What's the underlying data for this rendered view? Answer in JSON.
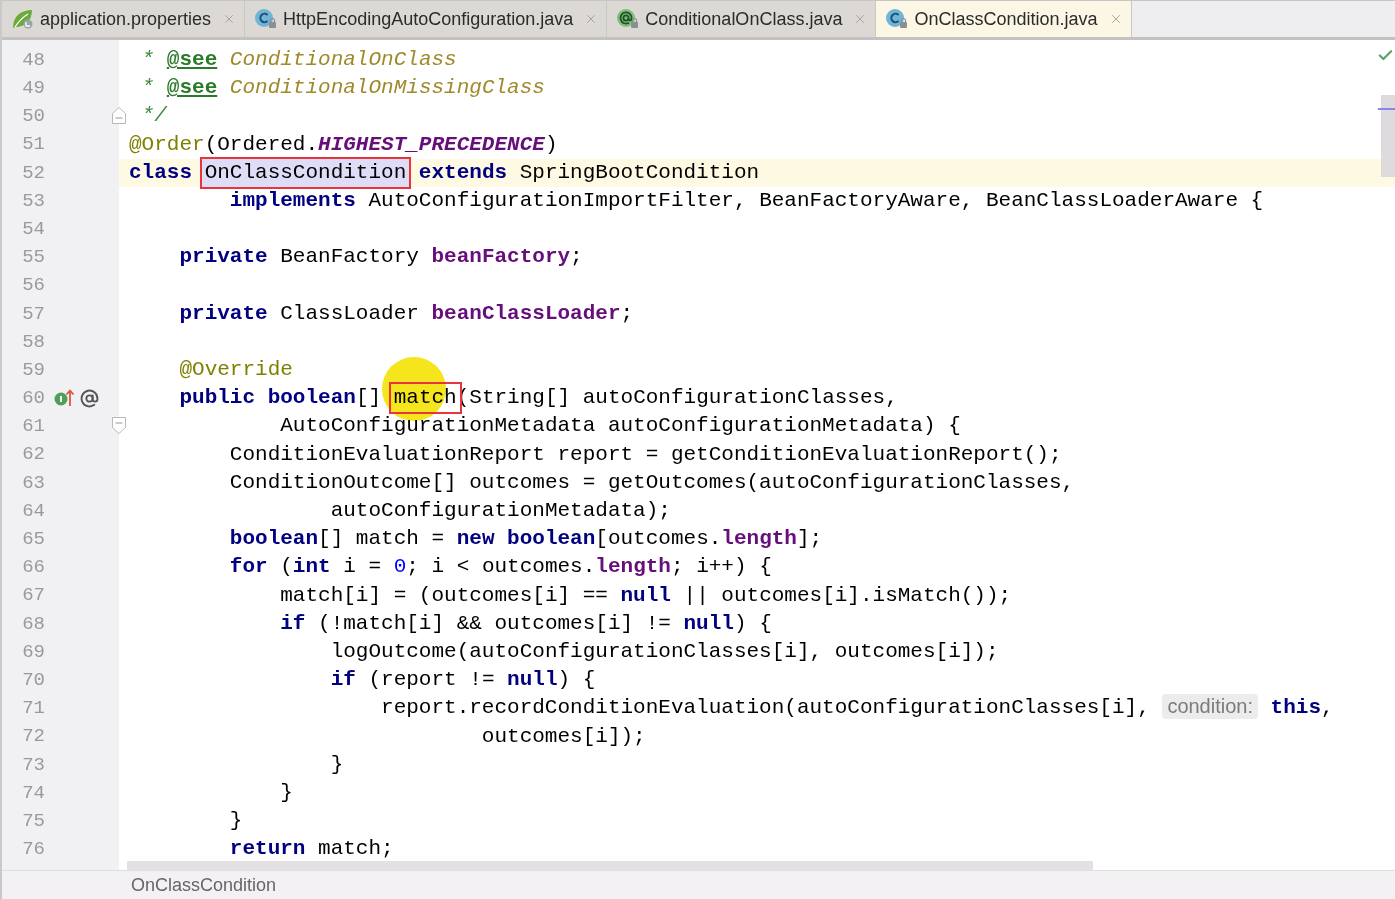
{
  "tabs": [
    {
      "label": "application.properties",
      "kind": "properties",
      "selected": false
    },
    {
      "label": "HttpEncodingAutoConfiguration.java",
      "kind": "class",
      "selected": false
    },
    {
      "label": "ConditionalOnClass.java",
      "kind": "annotation",
      "selected": false
    },
    {
      "label": "OnClassCondition.java",
      "kind": "class",
      "selected": true
    }
  ],
  "editor": {
    "lines": [
      {
        "number": "48",
        "current": false,
        "tokens": [
          {
            "kind": "doc",
            "text": " * "
          },
          {
            "kind": "doc_tag",
            "text": "@see"
          },
          {
            "kind": "doc_ref",
            "text": " ConditionalOnClass"
          }
        ]
      },
      {
        "number": "49",
        "current": false,
        "tokens": [
          {
            "kind": "doc",
            "text": " * "
          },
          {
            "kind": "doc_tag",
            "text": "@see"
          },
          {
            "kind": "doc_ref",
            "text": " ConditionalOnMissingClass"
          }
        ]
      },
      {
        "number": "50",
        "current": false,
        "fold": {
          "kind": "end"
        },
        "tokens": [
          {
            "kind": "doc",
            "text": " */"
          }
        ]
      },
      {
        "number": "51",
        "current": false,
        "tokens": [
          {
            "kind": "annotation",
            "text": "@Order"
          },
          {
            "kind": "plain",
            "text": "(Ordered."
          },
          {
            "kind": "constant",
            "text": "HIGHEST_PRECEDENCE"
          },
          {
            "kind": "plain",
            "text": ")"
          }
        ]
      },
      {
        "number": "52",
        "current": true,
        "tokens": [
          {
            "kind": "keyword",
            "text": "class "
          },
          {
            "kind": "plain",
            "text": "OnClassCondition",
            "boxed": true,
            "usage_highlight": true
          },
          {
            "kind": "keyword",
            "text": " extends"
          },
          {
            "kind": "plain",
            "text": " SpringBootCondition"
          }
        ]
      },
      {
        "number": "53",
        "current": false,
        "tokens": [
          {
            "kind": "keyword",
            "text": "        implements"
          },
          {
            "kind": "plain",
            "text": " AutoConfigurationImportFilter, BeanFactoryAware, BeanClassLoaderAware {"
          }
        ]
      },
      {
        "number": "54",
        "current": false
      },
      {
        "number": "55",
        "current": false,
        "tokens": [
          {
            "kind": "keyword",
            "text": "    private"
          },
          {
            "kind": "plain",
            "text": " BeanFactory "
          },
          {
            "kind": "field",
            "text": "beanFactory"
          },
          {
            "kind": "plain",
            "text": ";"
          }
        ]
      },
      {
        "number": "56",
        "current": false
      },
      {
        "number": "57",
        "current": false,
        "tokens": [
          {
            "kind": "keyword",
            "text": "    private"
          },
          {
            "kind": "plain",
            "text": " ClassLoader "
          },
          {
            "kind": "field",
            "text": "beanClassLoader"
          },
          {
            "kind": "plain",
            "text": ";"
          }
        ]
      },
      {
        "number": "58",
        "current": false
      },
      {
        "number": "59",
        "current": false,
        "tokens": [
          {
            "kind": "annotation",
            "text": "    @Override"
          }
        ]
      },
      {
        "number": "60",
        "current": false,
        "gutter_icons": [
          {
            "kind": "override"
          },
          {
            "kind": "annotation"
          }
        ],
        "tokens": [
          {
            "kind": "keyword",
            "text": "    public"
          },
          {
            "kind": "keyword",
            "text": " boolean"
          },
          {
            "kind": "plain",
            "text": "[] "
          },
          {
            "kind": "plain",
            "text": "match",
            "boxed": true,
            "cursor": true
          },
          {
            "kind": "plain",
            "text": "(String[] autoConfigurationClasses,"
          }
        ]
      },
      {
        "number": "61",
        "current": false,
        "fold": {
          "kind": "start"
        },
        "tokens": [
          {
            "kind": "plain",
            "text": "            AutoConfigurationMetadata autoConfigurationMetadata) {"
          }
        ]
      },
      {
        "number": "62",
        "current": false,
        "tokens": [
          {
            "kind": "plain",
            "text": "        ConditionEvaluationReport report = getConditionEvaluationReport();"
          }
        ]
      },
      {
        "number": "63",
        "current": false,
        "tokens": [
          {
            "kind": "plain",
            "text": "        ConditionOutcome[] outcomes = getOutcomes(autoConfigurationClasses,"
          }
        ]
      },
      {
        "number": "64",
        "current": false,
        "tokens": [
          {
            "kind": "plain",
            "text": "                autoConfigurationMetadata);"
          }
        ]
      },
      {
        "number": "65",
        "current": false,
        "tokens": [
          {
            "kind": "keyword",
            "text": "        boolean"
          },
          {
            "kind": "plain",
            "text": "[] match = "
          },
          {
            "kind": "keyword",
            "text": "new"
          },
          {
            "kind": "keyword",
            "text": " boolean"
          },
          {
            "kind": "plain",
            "text": "[outcomes."
          },
          {
            "kind": "field",
            "text": "length"
          },
          {
            "kind": "plain",
            "text": "];"
          }
        ]
      },
      {
        "number": "66",
        "current": false,
        "tokens": [
          {
            "kind": "keyword",
            "text": "        for"
          },
          {
            "kind": "plain",
            "text": " ("
          },
          {
            "kind": "keyword",
            "text": "int"
          },
          {
            "kind": "plain",
            "text": " i = "
          },
          {
            "kind": "number",
            "text": "0"
          },
          {
            "kind": "plain",
            "text": "; i < outcomes."
          },
          {
            "kind": "field",
            "text": "length"
          },
          {
            "kind": "plain",
            "text": "; i++) {"
          }
        ]
      },
      {
        "number": "67",
        "current": false,
        "tokens": [
          {
            "kind": "plain",
            "text": "            match[i] = (outcomes[i] == "
          },
          {
            "kind": "keyword",
            "text": "null"
          },
          {
            "kind": "plain",
            "text": " || outcomes[i].isMatch());"
          }
        ]
      },
      {
        "number": "68",
        "current": false,
        "tokens": [
          {
            "kind": "keyword",
            "text": "            if"
          },
          {
            "kind": "plain",
            "text": " (!match[i] && outcomes[i] != "
          },
          {
            "kind": "keyword",
            "text": "null"
          },
          {
            "kind": "plain",
            "text": ") {"
          }
        ]
      },
      {
        "number": "69",
        "current": false,
        "tokens": [
          {
            "kind": "plain",
            "text": "                logOutcome(autoConfigurationClasses[i], outcomes[i]);"
          }
        ]
      },
      {
        "number": "70",
        "current": false,
        "tokens": [
          {
            "kind": "keyword",
            "text": "                if"
          },
          {
            "kind": "plain",
            "text": " (report != "
          },
          {
            "kind": "keyword",
            "text": "null"
          },
          {
            "kind": "plain",
            "text": ") {"
          }
        ]
      },
      {
        "number": "71",
        "current": false,
        "tokens": [
          {
            "kind": "plain",
            "text": "                    report.recordConditionEvaluation(autoConfigurationClasses[i], "
          },
          {
            "kind": "hint",
            "text": "condition:"
          },
          {
            "kind": "keyword",
            "text": " this"
          },
          {
            "kind": "plain",
            "text": ","
          }
        ]
      },
      {
        "number": "72",
        "current": false,
        "tokens": [
          {
            "kind": "plain",
            "text": "                            outcomes[i]);"
          }
        ]
      },
      {
        "number": "73",
        "current": false,
        "tokens": [
          {
            "kind": "plain",
            "text": "                }"
          }
        ]
      },
      {
        "number": "74",
        "current": false,
        "tokens": [
          {
            "kind": "plain",
            "text": "            }"
          }
        ]
      },
      {
        "number": "75",
        "current": false,
        "tokens": [
          {
            "kind": "plain",
            "text": "        }"
          }
        ]
      },
      {
        "number": "76",
        "current": false,
        "tokens": [
          {
            "kind": "keyword",
            "text": "        return"
          },
          {
            "kind": "plain",
            "text": " match;"
          }
        ]
      }
    ]
  },
  "breadcrumb": {
    "items": [
      "OnClassCondition"
    ]
  }
}
